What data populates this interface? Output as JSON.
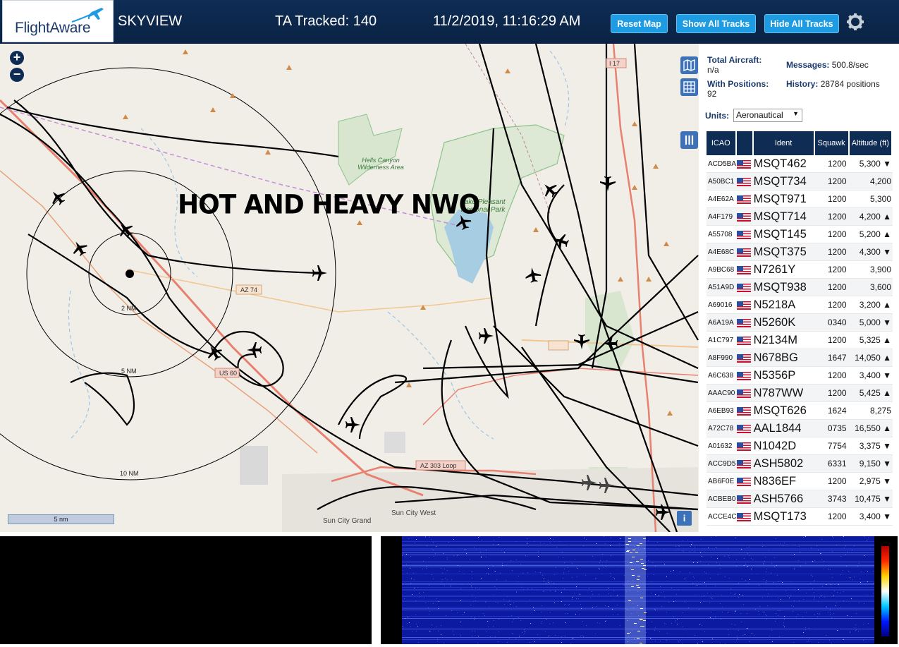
{
  "header": {
    "logo_text": "FlightAware",
    "app_name": "SKYVIEW",
    "tracked_label": "TA Tracked: 140",
    "datetime": "11/2/2019, 11:16:29 AM",
    "buttons": [
      "Reset Map",
      "Show All Tracks",
      "Hide All Tracks"
    ]
  },
  "map": {
    "overlay_text": "HOT AND HEAVY NWO",
    "zoom_in": "+",
    "zoom_out": "−",
    "scale_label": "5 nm",
    "info": "i",
    "labels": {
      "range_2": "2 NM",
      "range_5": "5 NM",
      "range_10": "10 NM",
      "az74": "AZ 74",
      "us60": "US 60",
      "az303": "AZ 303 Loop",
      "sun_city_west": "Sun City West",
      "sun_city_grand": "Sun City Grand",
      "hells_canyon": "Hells Canyon Wilderness Area",
      "lake_pleasant": "Lake Pleasant Regional Park",
      "i17": "I 17"
    }
  },
  "sidebar": {
    "stats": {
      "total_aircraft_label": "Total Aircraft:",
      "total_aircraft_value": "n/a",
      "with_positions_label": "With Positions:",
      "with_positions_value": "92",
      "messages_label": "Messages:",
      "messages_value": "500.8/sec",
      "history_label": "History:",
      "history_value": "28784 positions"
    },
    "units_label": "Units:",
    "units_value": "Aeronautical",
    "columns": [
      "ICAO",
      "",
      "Ident",
      "Squawk",
      "Altitude (ft)"
    ],
    "rows": [
      {
        "icao": "ACD5BA",
        "ident": "MSQT462",
        "squawk": "1200",
        "alt": "5,300 ▼"
      },
      {
        "icao": "A50BC1",
        "ident": "MSQT734",
        "squawk": "1200",
        "alt": "4,200"
      },
      {
        "icao": "A4E62A",
        "ident": "MSQT971",
        "squawk": "1200",
        "alt": "5,300"
      },
      {
        "icao": "A4F179",
        "ident": "MSQT714",
        "squawk": "1200",
        "alt": "4,200 ▲"
      },
      {
        "icao": "A55708",
        "ident": "MSQT145",
        "squawk": "1200",
        "alt": "5,200 ▲"
      },
      {
        "icao": "A4E68C",
        "ident": "MSQT375",
        "squawk": "1200",
        "alt": "4,300 ▼"
      },
      {
        "icao": "A9BC68",
        "ident": "N7261Y",
        "squawk": "1200",
        "alt": "3,900"
      },
      {
        "icao": "A51A9D",
        "ident": "MSQT938",
        "squawk": "1200",
        "alt": "3,600"
      },
      {
        "icao": "A69016",
        "ident": "N5218A",
        "squawk": "1200",
        "alt": "3,200 ▲"
      },
      {
        "icao": "A6A19A",
        "ident": "N5260K",
        "squawk": "0340",
        "alt": "5,000 ▼"
      },
      {
        "icao": "A1C797",
        "ident": "N2134M",
        "squawk": "1200",
        "alt": "5,325 ▲"
      },
      {
        "icao": "A8F990",
        "ident": "N678BG",
        "squawk": "1647",
        "alt": "14,050 ▲"
      },
      {
        "icao": "A6C638",
        "ident": "N5356P",
        "squawk": "1200",
        "alt": "3,400 ▼"
      },
      {
        "icao": "AAAC90",
        "ident": "N787WW",
        "squawk": "1200",
        "alt": "5,425 ▲"
      },
      {
        "icao": "A6EB93",
        "ident": "MSQT626",
        "squawk": "1624",
        "alt": "8,275"
      },
      {
        "icao": "A72C78",
        "ident": "AAL1844",
        "squawk": "0735",
        "alt": "16,550 ▲"
      },
      {
        "icao": "A01632",
        "ident": "N1042D",
        "squawk": "7754",
        "alt": "3,375 ▼"
      },
      {
        "icao": "ACC9D5",
        "ident": "ASH5802",
        "squawk": "6331",
        "alt": "9,150 ▼"
      },
      {
        "icao": "AB6F0E",
        "ident": "N836EF",
        "squawk": "1200",
        "alt": "2,975 ▼"
      },
      {
        "icao": "ACBEB0",
        "ident": "ASH5766",
        "squawk": "3743",
        "alt": "10,475 ▼"
      },
      {
        "icao": "ACCE4C",
        "ident": "MSQT173",
        "squawk": "1200",
        "alt": "3,400 ▼"
      }
    ]
  },
  "colors": {
    "header_bg": "#0e2c54",
    "button_bg": "#1d9be3",
    "waterfall_bg": "#0b1aa0"
  }
}
